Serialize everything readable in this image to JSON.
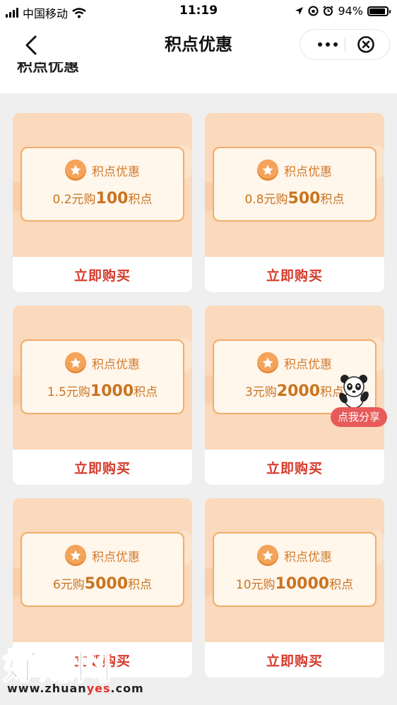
{
  "status_bar": {
    "carrier": "中国移动",
    "time": "11:19",
    "battery": "94%",
    "battery_level": 0.94
  },
  "nav": {
    "title": "积点优惠",
    "back_icon": "chevron-left-icon",
    "more_icon": "more-dots-icon",
    "close_icon": "close-circle-icon"
  },
  "page_heading": "积点优惠",
  "offers": [
    {
      "badge": "积点优惠",
      "price_prefix": "0.2元购",
      "points": "100",
      "unit": "积点",
      "button": "立即购买"
    },
    {
      "badge": "积点优惠",
      "price_prefix": "0.8元购",
      "points": "500",
      "unit": "积点",
      "button": "立即购买"
    },
    {
      "badge": "积点优惠",
      "price_prefix": "1.5元购",
      "points": "1000",
      "unit": "积点",
      "button": "立即购买"
    },
    {
      "badge": "积点优惠",
      "price_prefix": "3元购",
      "points": "2000",
      "unit": "积点",
      "button": "立即购买"
    },
    {
      "badge": "积点优惠",
      "price_prefix": "6元购",
      "points": "5000",
      "unit": "积点",
      "button": "立即购买"
    },
    {
      "badge": "积点优惠",
      "price_prefix": "10元购",
      "points": "10000",
      "unit": "积点",
      "button": "立即购买"
    }
  ],
  "share": {
    "label": "点我分享",
    "icon": "panda-mascot-icon"
  },
  "watermark": {
    "logo": "好赚网",
    "url_pre": "www.zhuan",
    "url_accent": "yes",
    "url_post": ".com"
  },
  "colors": {
    "accent_red": "#d6392b",
    "card_bg": "#fad9bd",
    "badge_orange": "#f4a45a",
    "share_red": "#e85a5a"
  }
}
